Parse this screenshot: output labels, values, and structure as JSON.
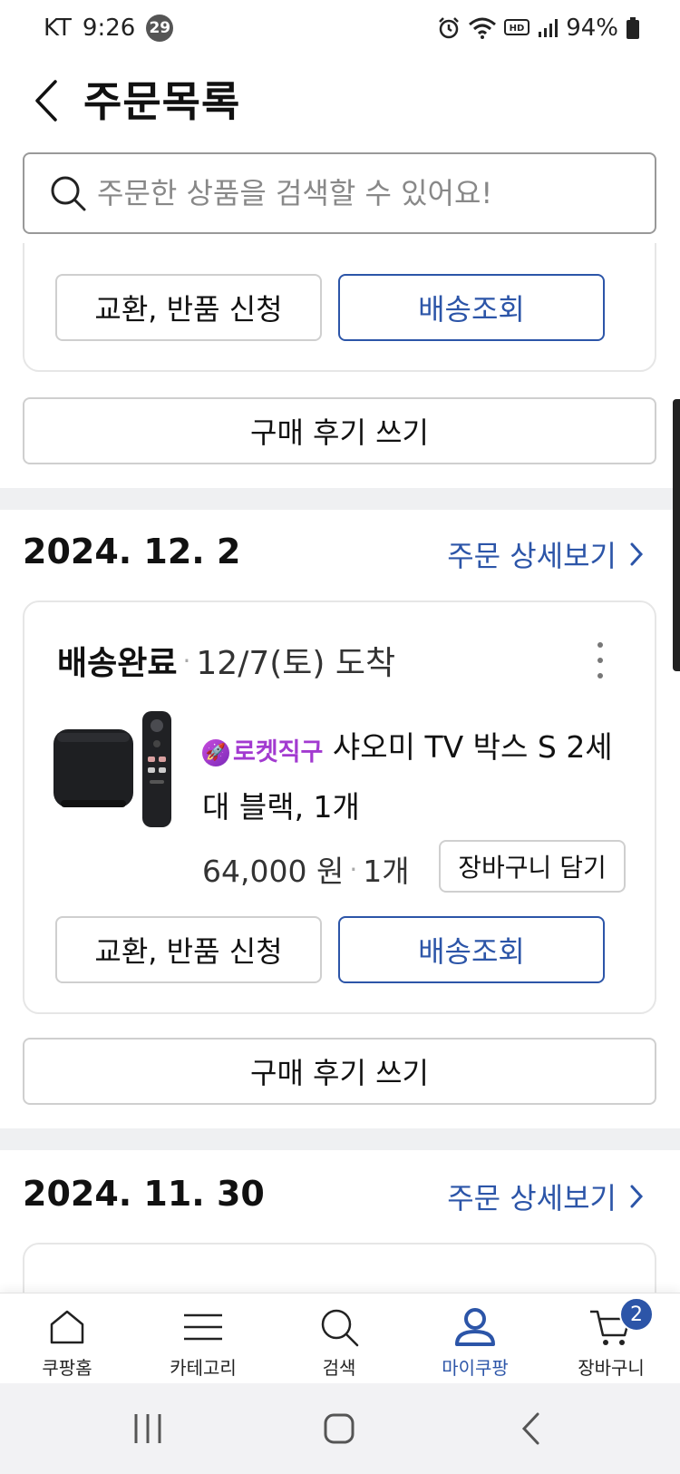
{
  "status_bar": {
    "carrier": "KT",
    "time": "9:26",
    "notification_count": "29",
    "battery": "94%"
  },
  "header": {
    "title": "주문목록"
  },
  "search": {
    "placeholder": "주문한 상품을 검색할 수 있어요!"
  },
  "prev_order": {
    "exchange_label": "교환, 반품 신청",
    "track_label": "배송조회",
    "review_label": "구매 후기 쓰기"
  },
  "orders": [
    {
      "date": "2024. 12. 2",
      "detail_link": "주문 상세보기",
      "status": "배송완료",
      "arrival": "12/7(토) 도착",
      "badge": "로켓직구",
      "product_name": "샤오미 TV 박스 S 2세대 블랙, 1개",
      "price": "64,000 원",
      "quantity": "1개",
      "cart_add_label": "장바구니 담기",
      "exchange_label": "교환, 반품 신청",
      "track_label": "배송조회",
      "review_label": "구매 후기 쓰기"
    },
    {
      "date": "2024. 11. 30",
      "detail_link": "주문 상세보기"
    }
  ],
  "bottom_nav": [
    {
      "label": "쿠팡홈",
      "icon": "home-icon"
    },
    {
      "label": "카테고리",
      "icon": "menu-icon"
    },
    {
      "label": "검색",
      "icon": "search-icon"
    },
    {
      "label": "마이쿠팡",
      "icon": "user-icon",
      "active": true
    },
    {
      "label": "장바구니",
      "icon": "cart-icon",
      "badge": "2"
    }
  ],
  "colors": {
    "accent": "#2c55a8",
    "rocket_purple": "#a23ad0",
    "divider_band": "#eff0f2"
  }
}
